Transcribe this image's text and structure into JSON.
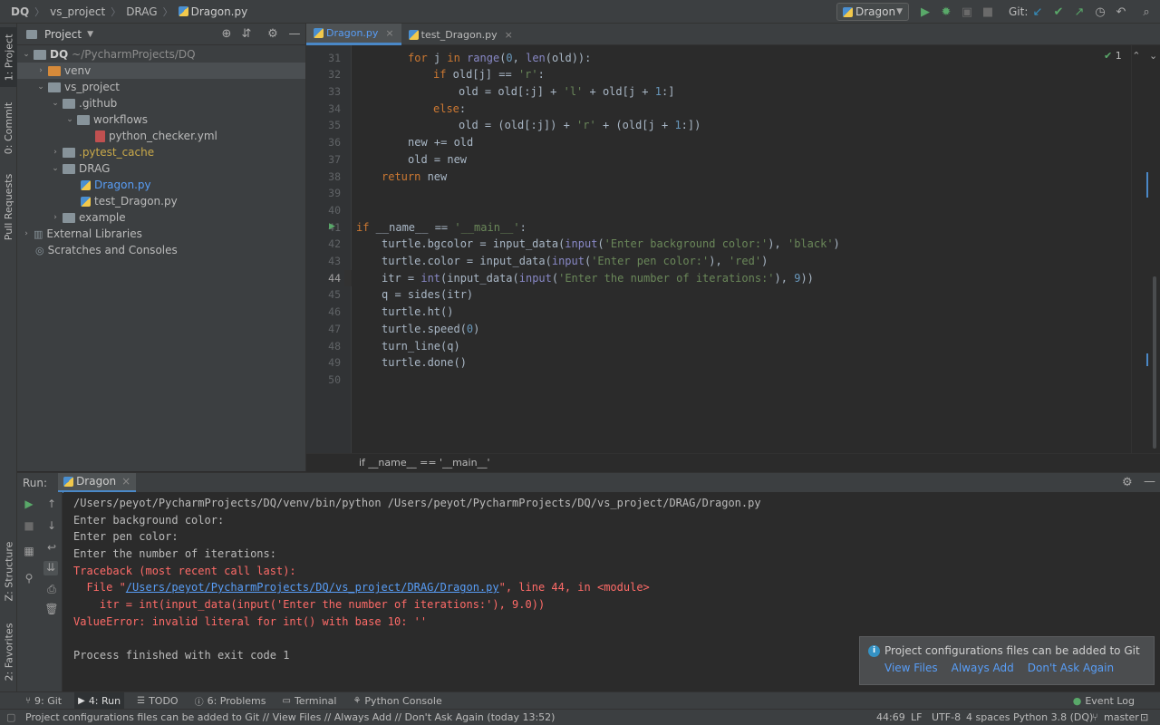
{
  "navbar": {
    "crumbs": [
      "DQ",
      "vs_project",
      "DRAG",
      "Dragon.py"
    ],
    "run_config": "Dragon",
    "git_label": "Git:"
  },
  "left_strip": {
    "project_tab": "1: Project",
    "commit_tab": "0: Commit",
    "pull_requests_tab": "Pull Requests",
    "structure_tab": "Z: Structure",
    "favorites_tab": "2: Favorites"
  },
  "project": {
    "title": "Project",
    "tree": [
      {
        "label": "DQ",
        "sub": "~/PycharmProjects/DQ"
      },
      {
        "label": "venv"
      },
      {
        "label": "vs_project"
      },
      {
        "label": ".github"
      },
      {
        "label": "workflows"
      },
      {
        "label": "python_checker.yml"
      },
      {
        "label": ".pytest_cache"
      },
      {
        "label": "DRAG"
      },
      {
        "label": "Dragon.py"
      },
      {
        "label": "test_Dragon.py"
      },
      {
        "label": "example"
      },
      {
        "label": "External Libraries"
      },
      {
        "label": "Scratches and Consoles"
      }
    ]
  },
  "editor": {
    "tabs": [
      "Dragon.py",
      "test_Dragon.py"
    ],
    "inspection_count": "1",
    "line_numbers": [
      "31",
      "32",
      "33",
      "34",
      "35",
      "36",
      "37",
      "38",
      "39",
      "40",
      "41",
      "42",
      "43",
      "44",
      "45",
      "46",
      "47",
      "48",
      "49",
      "50"
    ],
    "breadcrumb": "if __name__ == '__main__'"
  },
  "run": {
    "label": "Run:",
    "tab": "Dragon",
    "output": [
      "/Users/peyot/PycharmProjects/DQ/venv/bin/python /Users/peyot/PycharmProjects/DQ/vs_project/DRAG/Dragon.py",
      "Enter background color:",
      "Enter pen color:",
      "Enter the number of iterations:",
      "Traceback (most recent call last):",
      "  File \"",
      "/Users/peyot/PycharmProjects/DQ/vs_project/DRAG/Dragon.py",
      "\", line 44, in <module>",
      "    itr = int(input_data(input('Enter the number of iterations:'), 9.0))",
      "ValueError: invalid literal for int() with base 10: ''",
      "",
      "Process finished with exit code 1"
    ]
  },
  "notification": {
    "message": "Project configurations files can be added to Git",
    "actions": [
      "View Files",
      "Always Add",
      "Don't Ask Again"
    ]
  },
  "toolwindows": {
    "git": "9: Git",
    "run": "4: Run",
    "todo": "TODO",
    "problems": "6: Problems",
    "terminal": "Terminal",
    "python_console": "Python Console",
    "event_log": "Event Log"
  },
  "status": {
    "message": "Project configurations files can be added to Git // View Files // Always Add // Don't Ask Again (today 13:52)",
    "position": "44:69",
    "line_sep": "LF",
    "encoding": "UTF-8",
    "indent": "4 spaces",
    "interpreter": "Python 3.8 (DQ)",
    "branch": "master"
  }
}
